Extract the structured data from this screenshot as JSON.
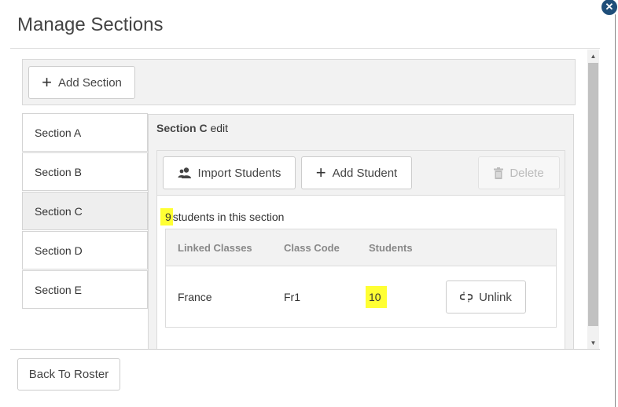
{
  "dialog": {
    "title": "Manage Sections",
    "close_icon": "close-icon",
    "back_label": "Back To Roster"
  },
  "toolbar": {
    "add_section_label": "Add Section"
  },
  "sections": [
    {
      "label": "Section A",
      "active": false
    },
    {
      "label": "Section B",
      "active": false
    },
    {
      "label": "Section C",
      "active": true
    },
    {
      "label": "Section D",
      "active": false
    },
    {
      "label": "Section E",
      "active": false
    }
  ],
  "edit": {
    "section_name": "Section C",
    "title_suffix": " edit",
    "import_label": "Import Students",
    "add_student_label": "Add Student",
    "delete_label": "Delete",
    "student_count": "9",
    "count_suffix": "students in this section"
  },
  "table": {
    "headers": [
      "Linked Classes",
      "Class Code",
      "Students"
    ],
    "rows": [
      {
        "class": "France",
        "code": "Fr1",
        "students": "10",
        "action": "Unlink"
      }
    ]
  },
  "colors": {
    "highlight": "#ffff33",
    "close_button": "#1f4e79"
  }
}
